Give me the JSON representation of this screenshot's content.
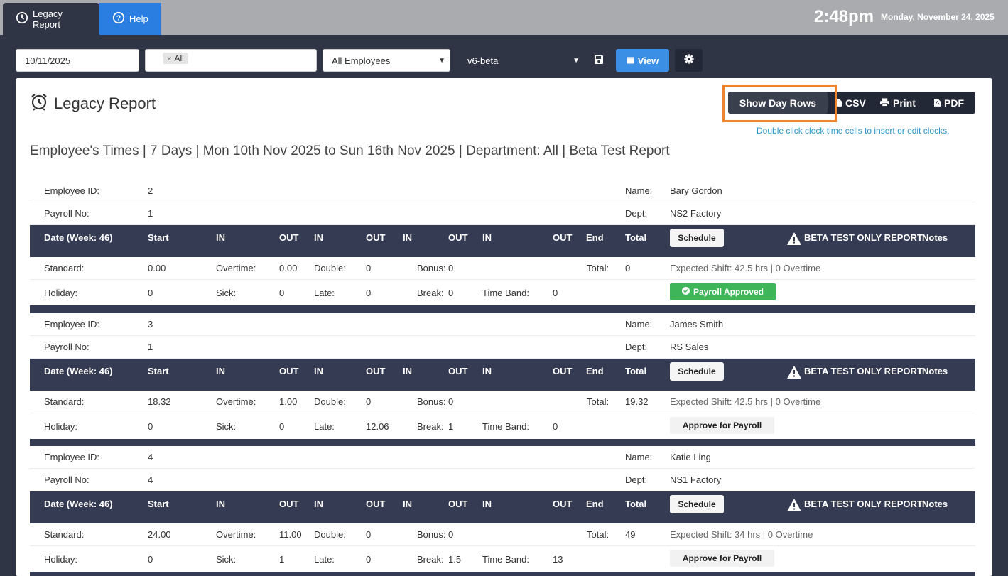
{
  "topbar": {
    "tab_legacy": "Legacy Report",
    "tab_help": "Help",
    "time": "2:48pm",
    "date": "Monday, November 24, 2025"
  },
  "filters": {
    "date": "10/11/2025",
    "tag": "All",
    "employees": "All Employees",
    "version": "v6-beta",
    "view_label": "View"
  },
  "card": {
    "title": "Legacy Report",
    "show_day_rows": "Show Day Rows",
    "csv": "CSV",
    "print": "Print",
    "pdf": "PDF",
    "hint": "Double click clock time cells to insert or edit clocks.",
    "report_title": "Employee's Times | 7 Days | Mon 10th Nov 2025 to Sun 16th Nov 2025 | Department: All | Beta Test Report"
  },
  "labels": {
    "employee_id": "Employee ID:",
    "payroll_no": "Payroll No:",
    "name": "Name:",
    "dept": "Dept:",
    "date_week": "Date (Week: 46)",
    "start": "Start",
    "in": "IN",
    "out": "OUT",
    "end": "End",
    "total": "Total",
    "schedule": "Schedule",
    "beta": "BETA TEST ONLY REPORT",
    "notes": "Notes",
    "standard": "Standard:",
    "overtime": "Overtime:",
    "double": "Double:",
    "bonus": "Bonus:",
    "total_colon": "Total:",
    "holiday": "Holiday:",
    "sick": "Sick:",
    "late": "Late:",
    "break": "Break:",
    "time_band": "Time Band:",
    "payroll_approved": "Payroll Approved",
    "approve_for_payroll": "Approve for Payroll"
  },
  "employees": [
    {
      "id": "2",
      "payroll": "1",
      "name": "Bary Gordon",
      "dept": "NS2 Factory",
      "standard": "0.00",
      "overtime": "0.00",
      "double": "0",
      "bonus": "0",
      "total": "0",
      "expected": "Expected Shift: 42.5 hrs | 0 Overtime",
      "holiday": "0",
      "sick": "0",
      "late": "0",
      "break": "0",
      "time_band": "0",
      "approved": true
    },
    {
      "id": "3",
      "payroll": "1",
      "name": "James Smith",
      "dept": "RS Sales",
      "standard": "18.32",
      "overtime": "1.00",
      "double": "0",
      "bonus": "0",
      "total": "19.32",
      "expected": "Expected Shift: 42.5 hrs | 0 Overtime",
      "holiday": "0",
      "sick": "0",
      "late": "12.06",
      "break": "1",
      "time_band": "0",
      "approved": false
    },
    {
      "id": "4",
      "payroll": "4",
      "name": "Katie Ling",
      "dept": "NS1 Factory",
      "standard": "24.00",
      "overtime": "11.00",
      "double": "0",
      "bonus": "0",
      "total": "49",
      "expected": "Expected Shift: 34 hrs | 0 Overtime",
      "holiday": "0",
      "sick": "1",
      "late": "0",
      "break": "1.5",
      "time_band": "13",
      "approved": false
    }
  ],
  "colors": {
    "header_bg": "#353b52",
    "accent_blue": "#3b8fe5",
    "approved_green": "#3db558",
    "highlight_orange": "#f0842b",
    "hint_blue": "#2a95c9"
  }
}
